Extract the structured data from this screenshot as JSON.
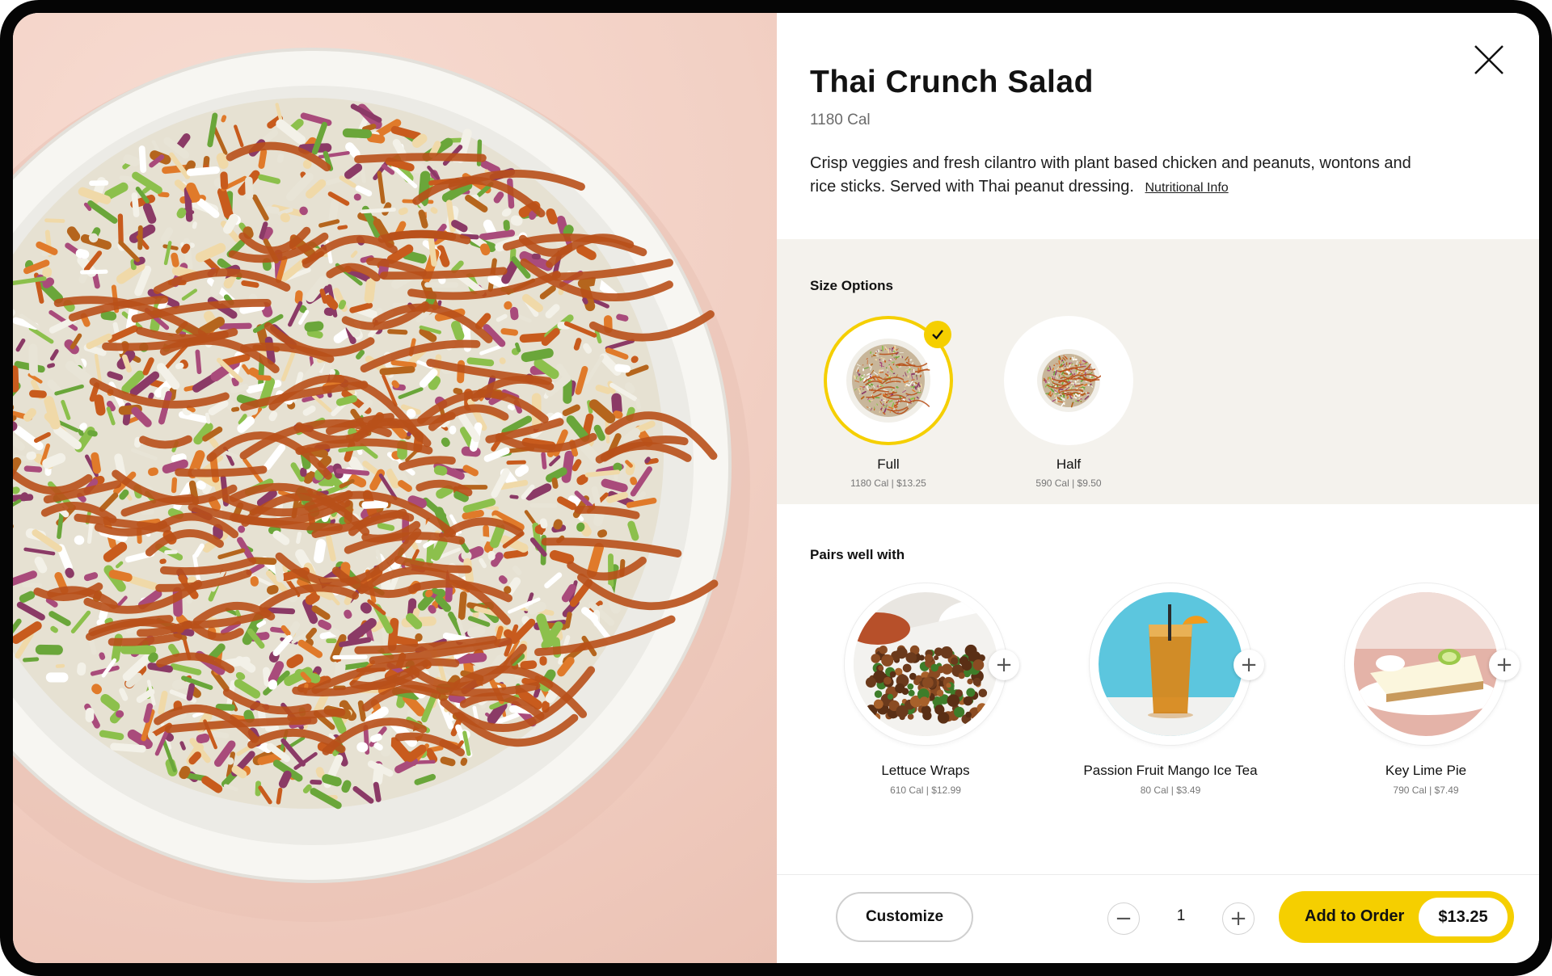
{
  "product": {
    "title": "Thai Crunch Salad",
    "calories": "1180 Cal",
    "description": "Crisp veggies and fresh cilantro with plant based chicken and peanuts, wontons and rice sticks. Served with Thai peanut dressing.",
    "nutrition_link": "Nutritional Info",
    "image": "thai-crunch-salad-bowl"
  },
  "size_options": {
    "heading": "Size Options",
    "options": [
      {
        "name": "Full",
        "meta": "1180 Cal | $13.25",
        "selected": true
      },
      {
        "name": "Half",
        "meta": "590 Cal | $9.50",
        "selected": false
      }
    ]
  },
  "pairs": {
    "heading": "Pairs well with",
    "items": [
      {
        "name": "Lettuce Wraps",
        "meta": "610 Cal | $12.99",
        "image": "lettuce-wraps"
      },
      {
        "name": "Passion Fruit Mango Ice Tea",
        "meta": "80 Cal | $3.49",
        "image": "iced-tea"
      },
      {
        "name": "Key Lime Pie",
        "meta": "790 Cal | $7.49",
        "image": "key-lime-pie"
      }
    ]
  },
  "footer": {
    "customize_label": "Customize",
    "quantity": "1",
    "add_label": "Add to Order",
    "price": "$13.25"
  },
  "colors": {
    "accent": "#f5cf00",
    "section_bg": "#f4f2ed",
    "photo_bg": "#f2d0c4"
  },
  "icons": {
    "close": "close-icon",
    "check": "check-icon",
    "add": "plus-icon",
    "minus": "minus-icon"
  }
}
